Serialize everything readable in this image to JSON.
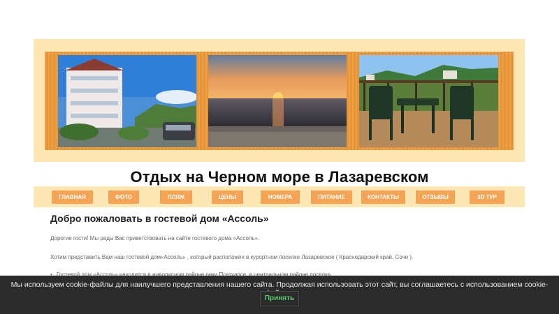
{
  "site": {
    "title": "Отдых на Черном море в Лазаревском"
  },
  "nav": {
    "items": [
      {
        "label": "ГЛАВНАЯ"
      },
      {
        "label": "ФОТО"
      },
      {
        "label": "ПЛЯЖ"
      },
      {
        "label": "ЦЕНЫ"
      },
      {
        "label": "НОМЕРА"
      },
      {
        "label": "ПИТАНИЕ"
      },
      {
        "label": "КОНТАКТЫ"
      },
      {
        "label": "ОТЗЫВЫ"
      },
      {
        "label": "3D ТУР"
      }
    ]
  },
  "content": {
    "heading": "Добро пожаловать в гостевой дом «Ассоль»",
    "p1": "Дорогие гости! Мы рады Вас приветствовать на сайте гостевого дома «Ассоль».",
    "p2": "Хотим представить Вам наш гостевой дом«Ассоль» , который расположен в курортном поселке Лазаревское ( Краснодарский край, Сочи ).",
    "bullet": "Гостевой дом «Ассоль» находится в живописном районе реки Псезуапсе, в центральном районе поселка"
  },
  "cookie": {
    "text": "Мы используем cookie-файлы для наилучшего представления нашего сайта. Продолжая использовать этот сайт, вы соглашаетесь с использованием cookie-файлов.",
    "accept_label": "Принять"
  },
  "colors": {
    "banner_bg": "#fde7b4",
    "frame_orange": "#ee9a3a",
    "nav_button": "#f4a454",
    "cookie_bar": "#2b2b2b",
    "accept_text": "#5ac46a"
  }
}
